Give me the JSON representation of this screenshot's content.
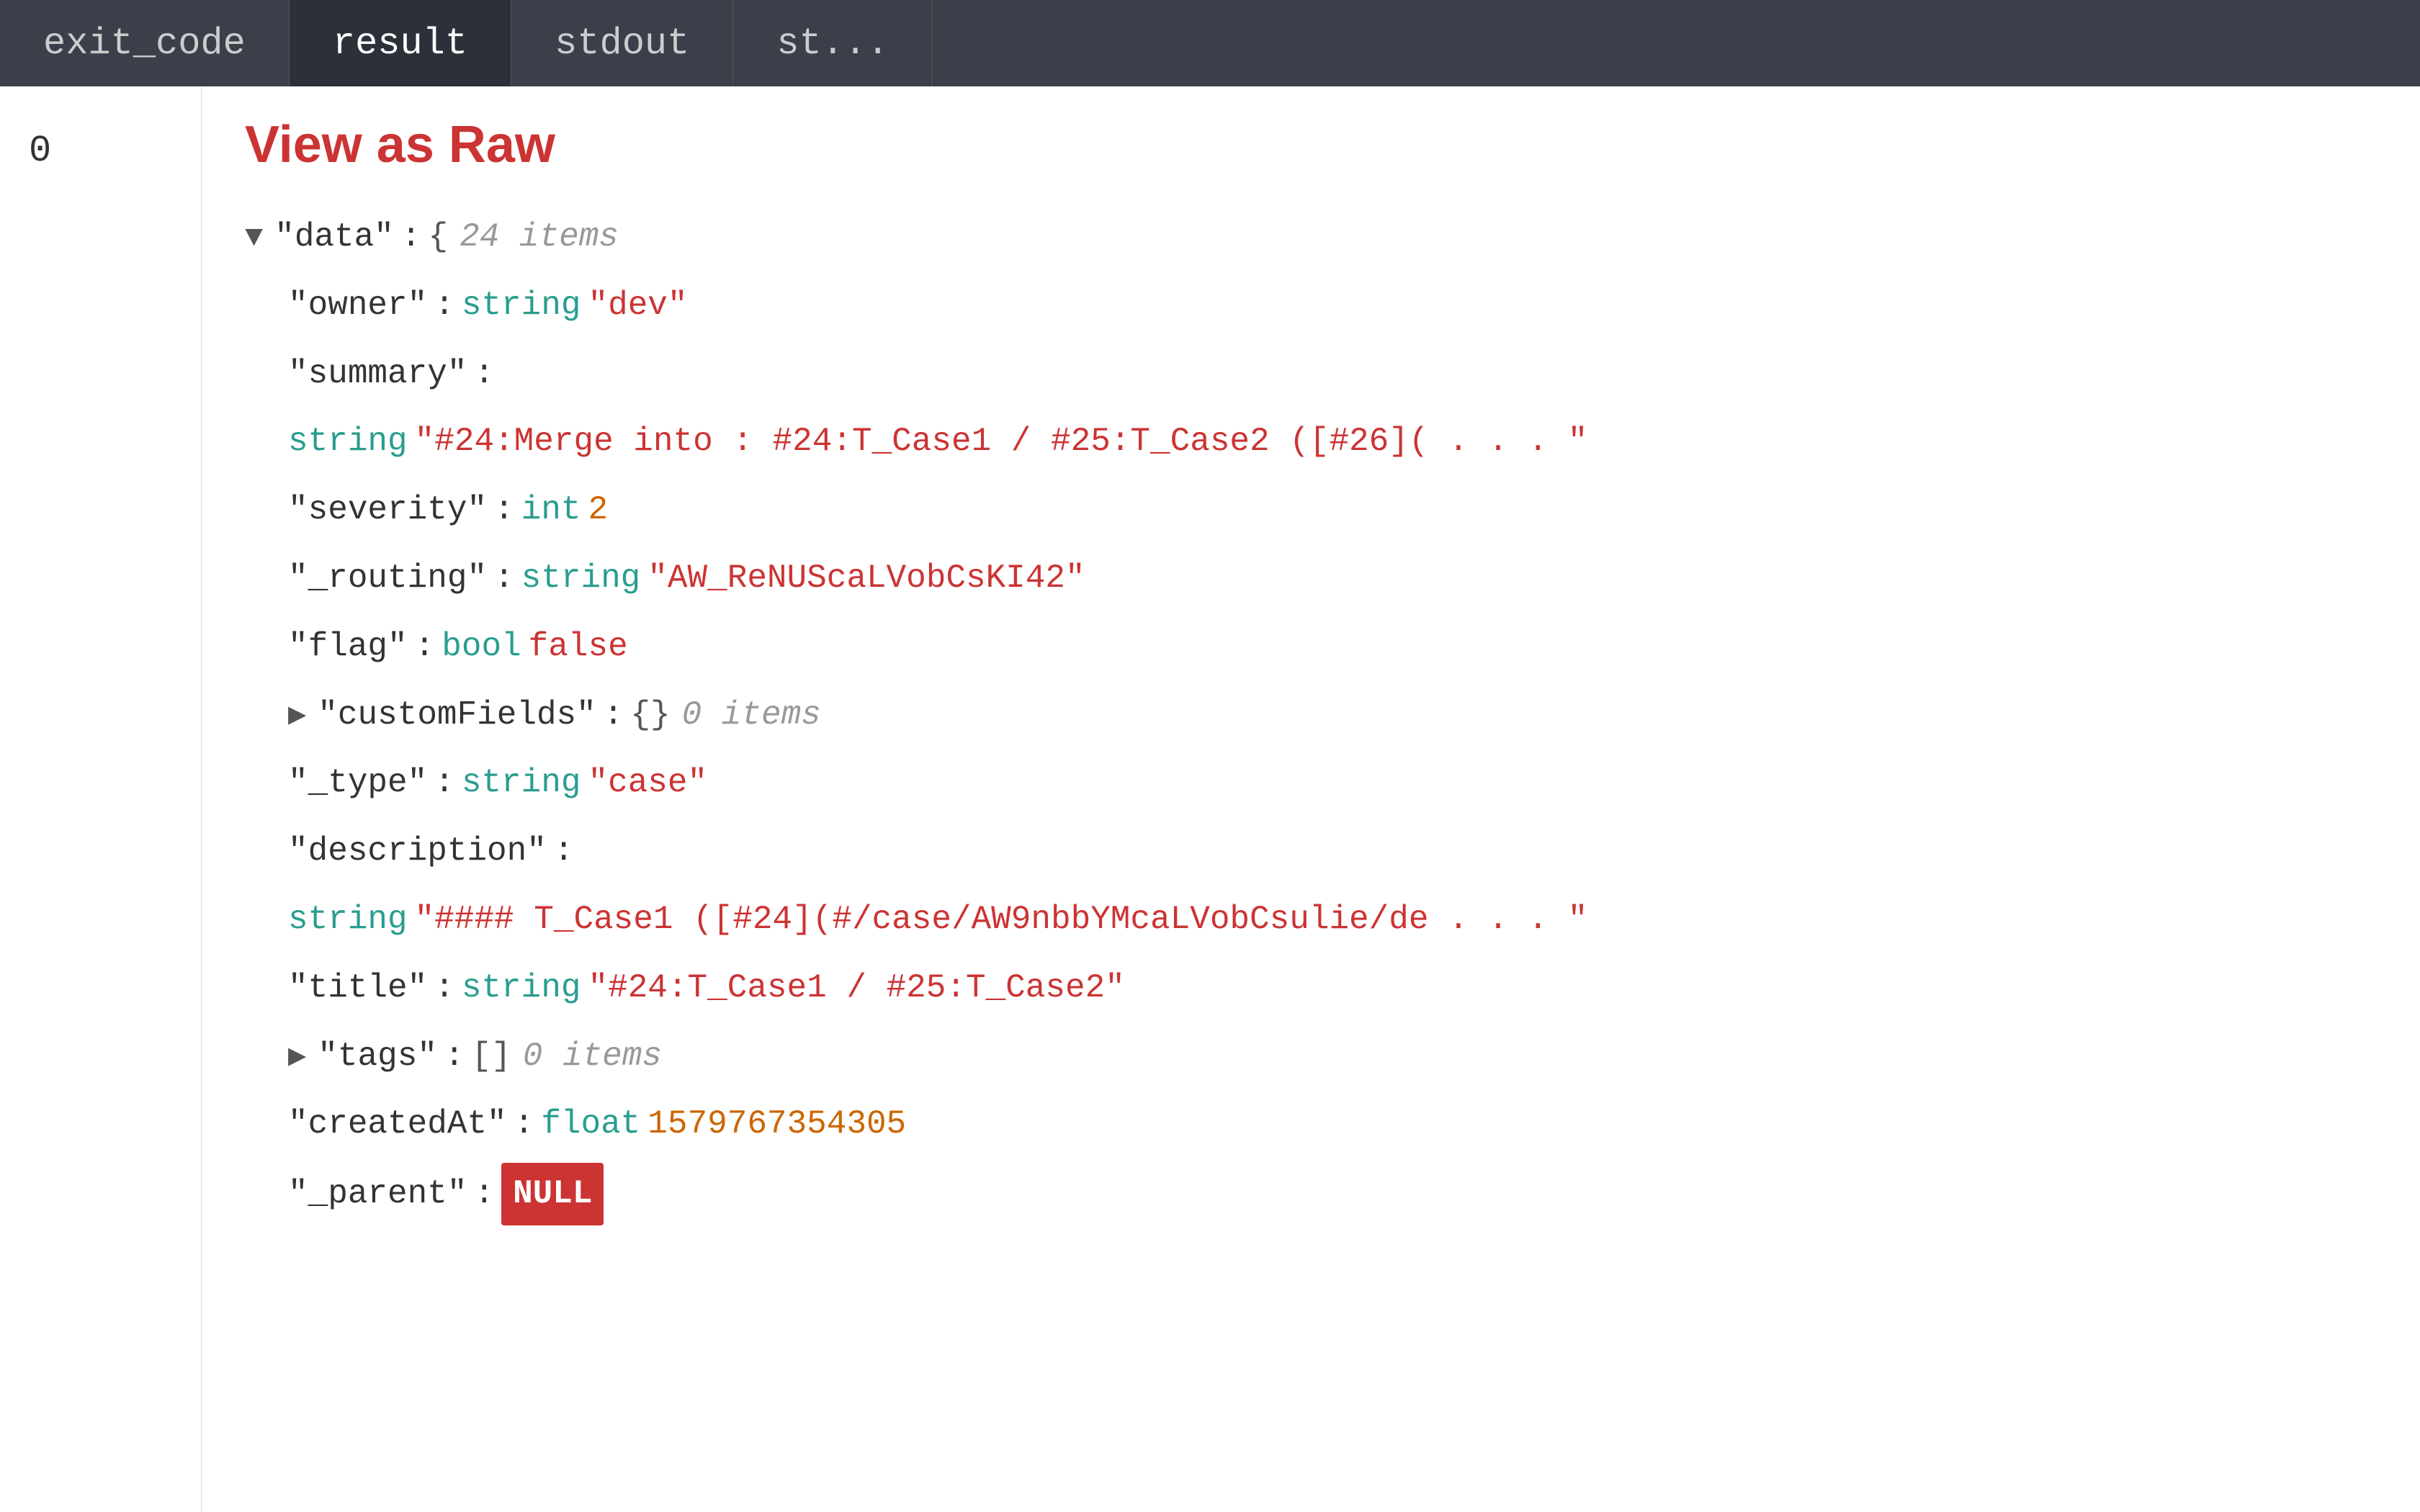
{
  "tabs": [
    {
      "id": "exit_code",
      "label": "exit_code"
    },
    {
      "id": "result",
      "label": "result",
      "active": true
    },
    {
      "id": "stdout",
      "label": "stdout"
    },
    {
      "id": "st",
      "label": "st..."
    }
  ],
  "exit_code": {
    "value": "0"
  },
  "result": {
    "view_as_raw_label": "View as Raw",
    "json": {
      "root_key": "\"data\"",
      "root_meta": "24 items",
      "fields": [
        {
          "key": "\"owner\"",
          "type": "string",
          "value": "\"dev\""
        },
        {
          "key": "\"summary\"",
          "type": "string",
          "value": "\"#24:Merge into : #24:T_Case1 / #25:T_Case2 ([#26](  . . . \""
        },
        {
          "key": "\"severity\"",
          "type": "int",
          "value": "2"
        },
        {
          "key": "\"_routing\"",
          "type": "string",
          "value": "\"AW_ReNUScaLVobCsKI42\""
        },
        {
          "key": "\"flag\"",
          "type": "bool",
          "value": "false"
        },
        {
          "key": "\"customFields\"",
          "type": "object",
          "brace": "{}",
          "meta": "0 items",
          "expandable": true
        },
        {
          "key": "\"_type\"",
          "type": "string",
          "value": "\"case\""
        },
        {
          "key": "\"description\"",
          "type": "string",
          "value": "\"#### T_Case1 ([#24](#/case/AW9nbbYMcaLVobCsulie/de  . . . \""
        },
        {
          "key": "\"title\"",
          "type": "string",
          "value": "\"#24:T_Case1 / #25:T_Case2\""
        },
        {
          "key": "\"tags\"",
          "type": "array",
          "bracket": "[]",
          "meta": "0 items",
          "expandable": true
        },
        {
          "key": "\"createdAt\"",
          "type": "float",
          "value": "1579767354305"
        },
        {
          "key": "\"_parent\"",
          "type": "null",
          "value": "NULL"
        }
      ]
    }
  }
}
